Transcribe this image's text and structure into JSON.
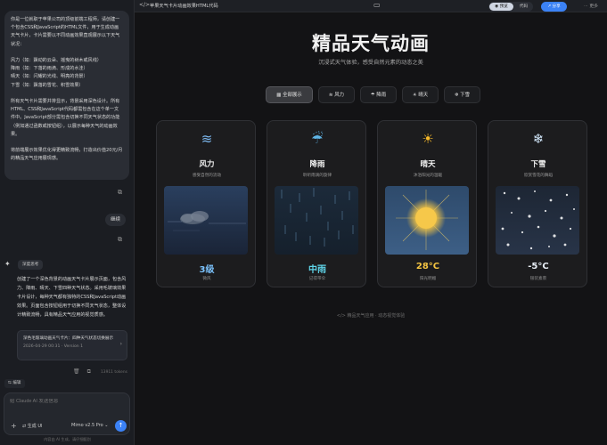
{
  "chat": {
    "user_prompt": "你是一位就职于苹果公司的顶级前端工程师，请创建一个包含CSS和JavaScript的HTML文件，用于生成动画天气卡片，卡片需要以不同动画效果直观展示以下天气状况：\n\n风力（如：飘动的云朵、摇曳的树木或风线）\n降雨（如：下落的雨滴、形成的水洼）\n晴天（如：闪耀的光线、明亮的背景）\n下雪（如：飘落的雪花、积雪效果）\n\n所有天气卡片需要并排显示，背景采用深色设计。所有HTML、CSS和JavaScript代码都需包含在这个单一文件中。JavaScript部分需包含切换不同天气状态的功能（例如通过函数或按钮组），以展示每种天气的动画效果。\n\n将前端展示效果优化得更精致流畅，打造出价值20元/月的精品天气应用展现感。",
    "continue_label": "继续",
    "think_label": "深度思考",
    "assistant_reply": "创建了一个深色背景的动画天气卡片展示页面，包含风力、降雨、晴天、下雪四种天气状态。采用毛玻璃效果卡片设计，每种天气都有独特的CSS和JavaScript动画效果。页面包含按钮组用于切换不同天气状态，整体设计精致流畅，具有精品天气应用的视觉质感。",
    "artifact_title": "深色毛玻璃动画天气卡片：四种天气状态切换展示",
    "artifact_date": "2026-04-29 00:31 · Version 1",
    "tokens": "13911 tokens",
    "edit_label": "编辑",
    "input_placeholder": "给 Claude AI 发送信息",
    "generate_label": "生成 UI",
    "model_label": "Mimo v2.5 Pro",
    "footer_note": "内容由 AI 生成，请仔细甄别"
  },
  "topbar": {
    "title": "苹果天气卡片动画效果HTML代码",
    "preview_label": "预览",
    "code_label": "代码",
    "share_label": "分享",
    "more_label": "更多"
  },
  "preview": {
    "title": "精品天气动画",
    "subtitle": "沉浸式天气体验，感受自然元素的动态之美",
    "filters": [
      {
        "label": "全部展示",
        "icon": "grid-icon"
      },
      {
        "label": "风力",
        "icon": "wind-icon"
      },
      {
        "label": "降雨",
        "icon": "rain-icon"
      },
      {
        "label": "晴天",
        "icon": "sun-icon"
      },
      {
        "label": "下雪",
        "icon": "snowflake-icon"
      }
    ],
    "cards": [
      {
        "name": "风力",
        "desc": "感受自然的流动",
        "value": "3级",
        "note": "微风",
        "value_color": "#7cc4ff",
        "icon": "wind-icon"
      },
      {
        "name": "降雨",
        "desc": "聆听雨滴的旋律",
        "value": "中雨",
        "note": "记得带伞",
        "value_color": "#5fd4e8",
        "icon": "rain-icon"
      },
      {
        "name": "晴天",
        "desc": "沐浴阳光的温暖",
        "value": "28°C",
        "note": "阳光明媚",
        "value_color": "#f5c542",
        "icon": "sun-icon"
      },
      {
        "name": "下雪",
        "desc": "欣赏雪花的舞蹈",
        "value": "-5°C",
        "note": "银装素裹",
        "value_color": "#e8eef5",
        "icon": "snowflake-icon"
      }
    ],
    "footer": "精品天气应用 · 动态视觉体验"
  }
}
